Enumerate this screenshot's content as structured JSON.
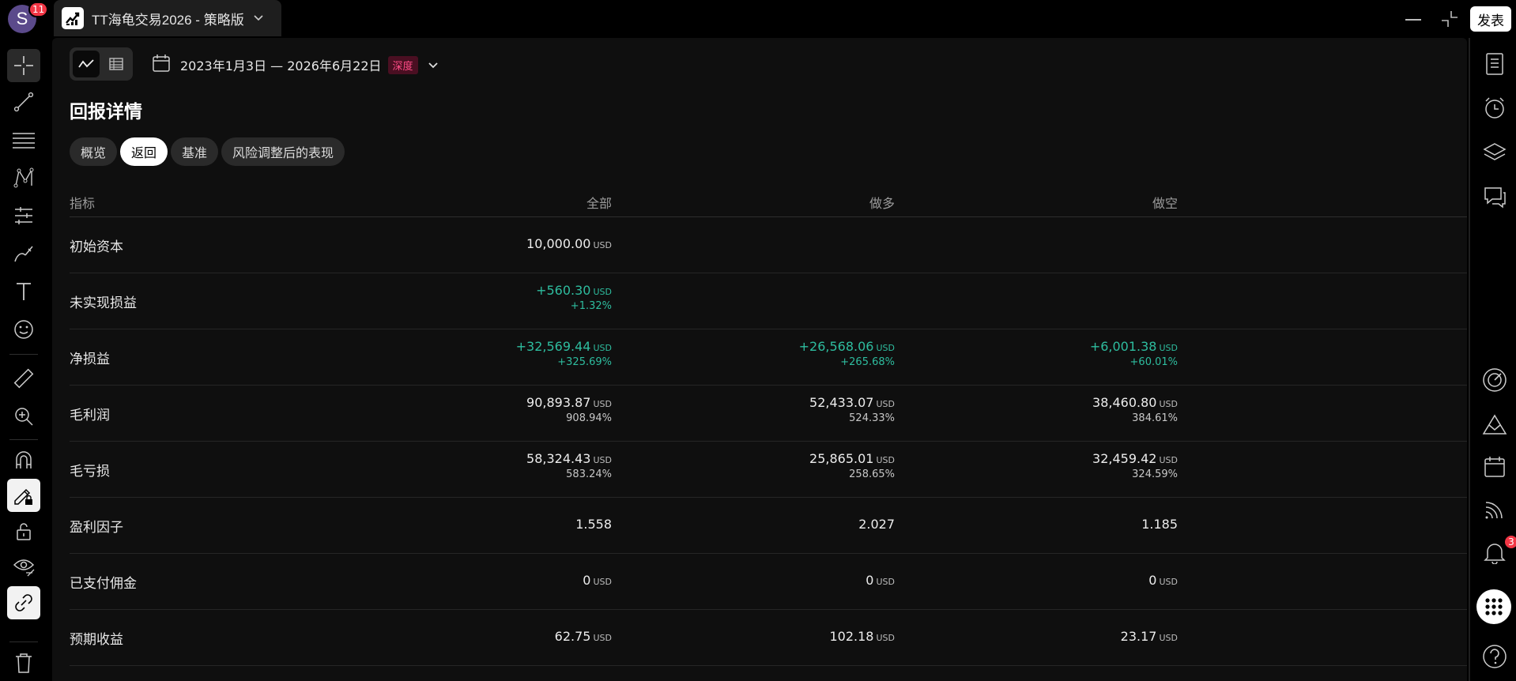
{
  "top": {
    "avatar_letter": "S",
    "avatar_badge": "11",
    "tab_title": "TT海龟交易2026 - 策略版",
    "publish_label": "发表"
  },
  "toolbar": {
    "date_range": "2023年1月3日 — 2026年6月22日",
    "deep_badge": "深度"
  },
  "section": {
    "title": "回报详情",
    "tabs": [
      "概览",
      "返回",
      "基准",
      "风险调整后的表现"
    ],
    "active_tab": "返回"
  },
  "table": {
    "headers": [
      "指标",
      "全部",
      "做多",
      "做空"
    ],
    "rows": [
      {
        "label": "初始资本",
        "all": {
          "v": "10,000.00",
          "u": "USD",
          "s": ""
        },
        "long": {
          "v": "",
          "u": "",
          "s": ""
        },
        "short": {
          "v": "",
          "u": "",
          "s": ""
        }
      },
      {
        "label": "未实现损益",
        "all": {
          "v": "+560.30",
          "u": "USD",
          "s": "+1.32%",
          "pos": true
        },
        "long": {
          "v": "",
          "u": "",
          "s": ""
        },
        "short": {
          "v": "",
          "u": "",
          "s": ""
        }
      },
      {
        "label": "净损益",
        "all": {
          "v": "+32,569.44",
          "u": "USD",
          "s": "+325.69%",
          "pos": true
        },
        "long": {
          "v": "+26,568.06",
          "u": "USD",
          "s": "+265.68%",
          "pos": true
        },
        "short": {
          "v": "+6,001.38",
          "u": "USD",
          "s": "+60.01%",
          "pos": true
        }
      },
      {
        "label": "毛利润",
        "all": {
          "v": "90,893.87",
          "u": "USD",
          "s": "908.94%"
        },
        "long": {
          "v": "52,433.07",
          "u": "USD",
          "s": "524.33%"
        },
        "short": {
          "v": "38,460.80",
          "u": "USD",
          "s": "384.61%"
        }
      },
      {
        "label": "毛亏损",
        "all": {
          "v": "58,324.43",
          "u": "USD",
          "s": "583.24%"
        },
        "long": {
          "v": "25,865.01",
          "u": "USD",
          "s": "258.65%"
        },
        "short": {
          "v": "32,459.42",
          "u": "USD",
          "s": "324.59%"
        }
      },
      {
        "label": "盈利因子",
        "all": {
          "v": "1.558",
          "u": "",
          "s": ""
        },
        "long": {
          "v": "2.027",
          "u": "",
          "s": ""
        },
        "short": {
          "v": "1.185",
          "u": "",
          "s": ""
        }
      },
      {
        "label": "已支付佣金",
        "all": {
          "v": "0",
          "u": "USD",
          "s": ""
        },
        "long": {
          "v": "0",
          "u": "USD",
          "s": ""
        },
        "short": {
          "v": "0",
          "u": "USD",
          "s": ""
        }
      },
      {
        "label": "预期收益",
        "all": {
          "v": "62.75",
          "u": "USD",
          "s": ""
        },
        "long": {
          "v": "102.18",
          "u": "USD",
          "s": ""
        },
        "short": {
          "v": "23.17",
          "u": "USD",
          "s": ""
        }
      }
    ]
  },
  "right": {
    "bell_badge": "3"
  },
  "colors": {
    "positive": "#2ebd9f",
    "badge_red": "#f23645",
    "deep_badge_text": "#ff4c86"
  }
}
